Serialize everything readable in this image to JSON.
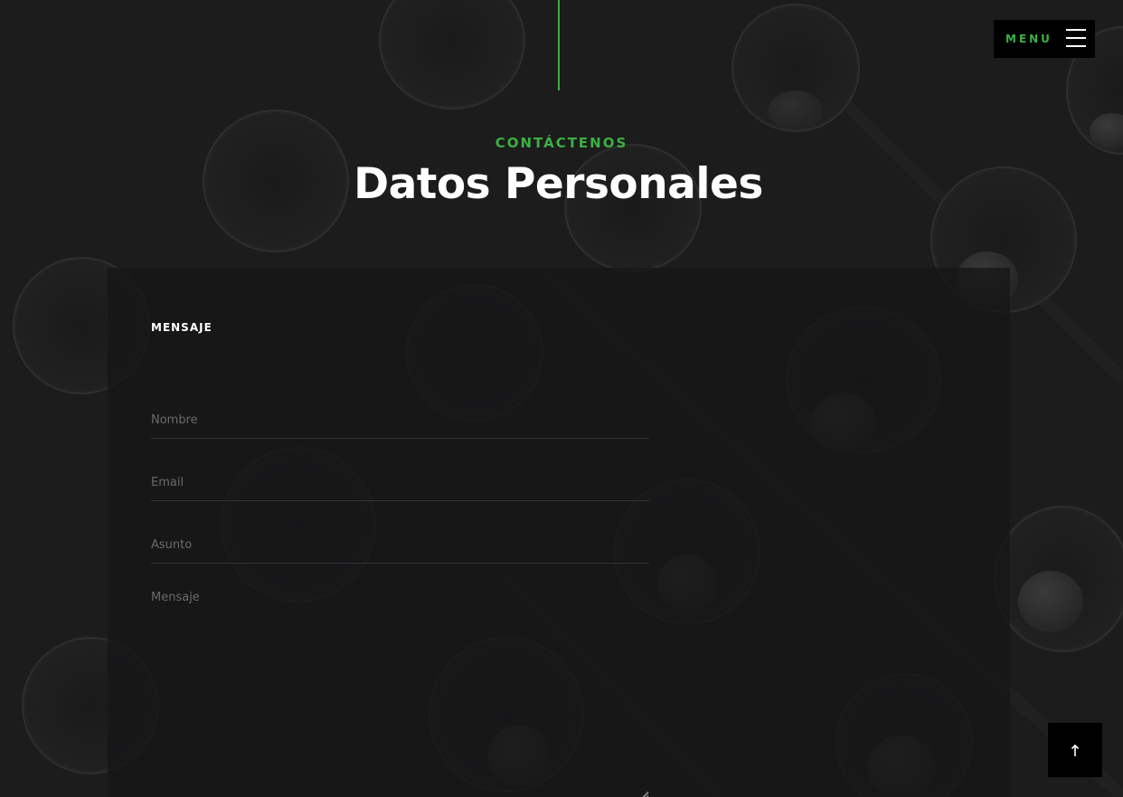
{
  "header": {
    "menu_label": "MENU",
    "subtitle": "CONTÁCTENOS",
    "title": "Datos Personales"
  },
  "form": {
    "heading": "MENSAJE",
    "fields": {
      "nombre_placeholder": "Nombre",
      "email_placeholder": "Email",
      "asunto_placeholder": "Asunto",
      "mensaje_placeholder": "Mensaje"
    }
  },
  "icons": {
    "menu": "hamburger-icon",
    "scroll_top": "arrow-up-icon"
  },
  "colors": {
    "accent": "#3cb043",
    "background": "#1c1c1d",
    "panel": "#161617"
  }
}
